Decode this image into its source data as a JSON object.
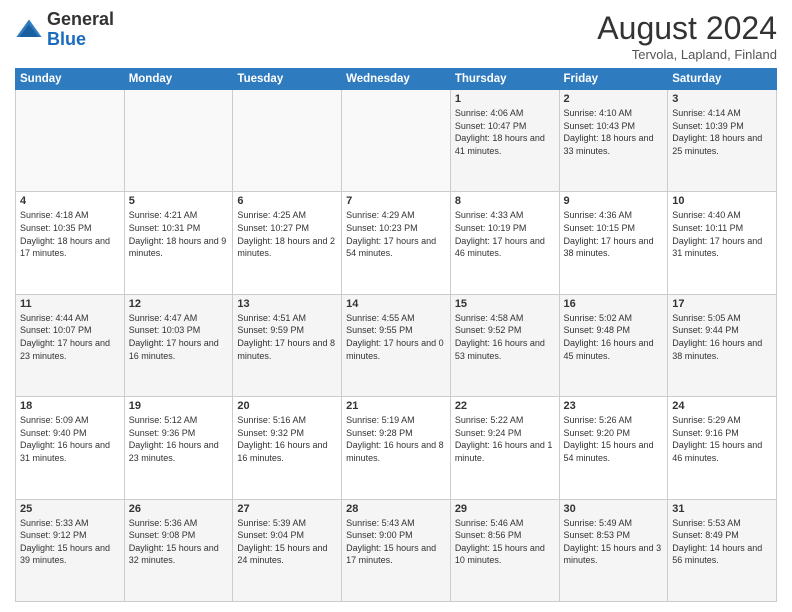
{
  "header": {
    "logo": {
      "general": "General",
      "blue": "Blue"
    },
    "title": "August 2024",
    "location": "Tervola, Lapland, Finland"
  },
  "days_of_week": [
    "Sunday",
    "Monday",
    "Tuesday",
    "Wednesday",
    "Thursday",
    "Friday",
    "Saturday"
  ],
  "weeks": [
    [
      {
        "day": "",
        "info": ""
      },
      {
        "day": "",
        "info": ""
      },
      {
        "day": "",
        "info": ""
      },
      {
        "day": "",
        "info": ""
      },
      {
        "day": "1",
        "info": "Sunrise: 4:06 AM\nSunset: 10:47 PM\nDaylight: 18 hours\nand 41 minutes."
      },
      {
        "day": "2",
        "info": "Sunrise: 4:10 AM\nSunset: 10:43 PM\nDaylight: 18 hours\nand 33 minutes."
      },
      {
        "day": "3",
        "info": "Sunrise: 4:14 AM\nSunset: 10:39 PM\nDaylight: 18 hours\nand 25 minutes."
      }
    ],
    [
      {
        "day": "4",
        "info": "Sunrise: 4:18 AM\nSunset: 10:35 PM\nDaylight: 18 hours\nand 17 minutes."
      },
      {
        "day": "5",
        "info": "Sunrise: 4:21 AM\nSunset: 10:31 PM\nDaylight: 18 hours\nand 9 minutes."
      },
      {
        "day": "6",
        "info": "Sunrise: 4:25 AM\nSunset: 10:27 PM\nDaylight: 18 hours\nand 2 minutes."
      },
      {
        "day": "7",
        "info": "Sunrise: 4:29 AM\nSunset: 10:23 PM\nDaylight: 17 hours\nand 54 minutes."
      },
      {
        "day": "8",
        "info": "Sunrise: 4:33 AM\nSunset: 10:19 PM\nDaylight: 17 hours\nand 46 minutes."
      },
      {
        "day": "9",
        "info": "Sunrise: 4:36 AM\nSunset: 10:15 PM\nDaylight: 17 hours\nand 38 minutes."
      },
      {
        "day": "10",
        "info": "Sunrise: 4:40 AM\nSunset: 10:11 PM\nDaylight: 17 hours\nand 31 minutes."
      }
    ],
    [
      {
        "day": "11",
        "info": "Sunrise: 4:44 AM\nSunset: 10:07 PM\nDaylight: 17 hours\nand 23 minutes."
      },
      {
        "day": "12",
        "info": "Sunrise: 4:47 AM\nSunset: 10:03 PM\nDaylight: 17 hours\nand 16 minutes."
      },
      {
        "day": "13",
        "info": "Sunrise: 4:51 AM\nSunset: 9:59 PM\nDaylight: 17 hours\nand 8 minutes."
      },
      {
        "day": "14",
        "info": "Sunrise: 4:55 AM\nSunset: 9:55 PM\nDaylight: 17 hours\nand 0 minutes."
      },
      {
        "day": "15",
        "info": "Sunrise: 4:58 AM\nSunset: 9:52 PM\nDaylight: 16 hours\nand 53 minutes."
      },
      {
        "day": "16",
        "info": "Sunrise: 5:02 AM\nSunset: 9:48 PM\nDaylight: 16 hours\nand 45 minutes."
      },
      {
        "day": "17",
        "info": "Sunrise: 5:05 AM\nSunset: 9:44 PM\nDaylight: 16 hours\nand 38 minutes."
      }
    ],
    [
      {
        "day": "18",
        "info": "Sunrise: 5:09 AM\nSunset: 9:40 PM\nDaylight: 16 hours\nand 31 minutes."
      },
      {
        "day": "19",
        "info": "Sunrise: 5:12 AM\nSunset: 9:36 PM\nDaylight: 16 hours\nand 23 minutes."
      },
      {
        "day": "20",
        "info": "Sunrise: 5:16 AM\nSunset: 9:32 PM\nDaylight: 16 hours\nand 16 minutes."
      },
      {
        "day": "21",
        "info": "Sunrise: 5:19 AM\nSunset: 9:28 PM\nDaylight: 16 hours\nand 8 minutes."
      },
      {
        "day": "22",
        "info": "Sunrise: 5:22 AM\nSunset: 9:24 PM\nDaylight: 16 hours\nand 1 minute."
      },
      {
        "day": "23",
        "info": "Sunrise: 5:26 AM\nSunset: 9:20 PM\nDaylight: 15 hours\nand 54 minutes."
      },
      {
        "day": "24",
        "info": "Sunrise: 5:29 AM\nSunset: 9:16 PM\nDaylight: 15 hours\nand 46 minutes."
      }
    ],
    [
      {
        "day": "25",
        "info": "Sunrise: 5:33 AM\nSunset: 9:12 PM\nDaylight: 15 hours\nand 39 minutes."
      },
      {
        "day": "26",
        "info": "Sunrise: 5:36 AM\nSunset: 9:08 PM\nDaylight: 15 hours\nand 32 minutes."
      },
      {
        "day": "27",
        "info": "Sunrise: 5:39 AM\nSunset: 9:04 PM\nDaylight: 15 hours\nand 24 minutes."
      },
      {
        "day": "28",
        "info": "Sunrise: 5:43 AM\nSunset: 9:00 PM\nDaylight: 15 hours\nand 17 minutes."
      },
      {
        "day": "29",
        "info": "Sunrise: 5:46 AM\nSunset: 8:56 PM\nDaylight: 15 hours\nand 10 minutes."
      },
      {
        "day": "30",
        "info": "Sunrise: 5:49 AM\nSunset: 8:53 PM\nDaylight: 15 hours\nand 3 minutes."
      },
      {
        "day": "31",
        "info": "Sunrise: 5:53 AM\nSunset: 8:49 PM\nDaylight: 14 hours\nand 56 minutes."
      }
    ]
  ]
}
